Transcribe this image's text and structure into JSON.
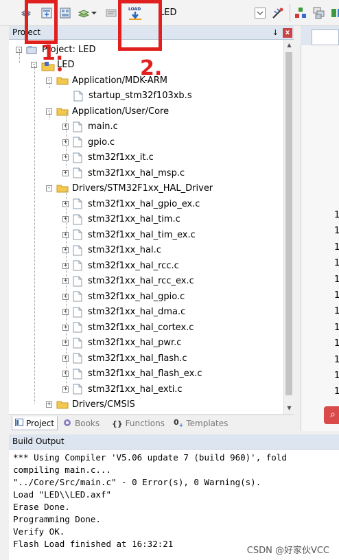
{
  "toolbar": {
    "target_name": "LED",
    "load_label": "LOAD"
  },
  "project_panel": {
    "title": "Project",
    "close_label": "x",
    "pin_label": "↓"
  },
  "tree": {
    "root_label": "Project: LED",
    "target_label": "LED",
    "groups": [
      {
        "label": "Application/MDK-ARM",
        "files": [
          "startup_stm32f103xb.s"
        ]
      },
      {
        "label": "Application/User/Core",
        "files": [
          "main.c",
          "gpio.c",
          "stm32f1xx_it.c",
          "stm32f1xx_hal_msp.c"
        ]
      },
      {
        "label": "Drivers/STM32F1xx_HAL_Driver",
        "files": [
          "stm32f1xx_hal_gpio_ex.c",
          "stm32f1xx_hal_tim.c",
          "stm32f1xx_hal_tim_ex.c",
          "stm32f1xx_hal.c",
          "stm32f1xx_hal_rcc.c",
          "stm32f1xx_hal_rcc_ex.c",
          "stm32f1xx_hal_gpio.c",
          "stm32f1xx_hal_dma.c",
          "stm32f1xx_hal_cortex.c",
          "stm32f1xx_hal_pwr.c",
          "stm32f1xx_hal_flash.c",
          "stm32f1xx_hal_flash_ex.c",
          "stm32f1xx_hal_exti.c"
        ]
      },
      {
        "label": "Drivers/CMSIS",
        "files": []
      }
    ]
  },
  "bottom_tabs": [
    {
      "label": "Project",
      "icon": "project-icon",
      "active": true
    },
    {
      "label": "Books",
      "icon": "books-icon",
      "active": false
    },
    {
      "label": "Functions",
      "icon": "functions-icon",
      "active": false
    },
    {
      "label": "Templates",
      "icon": "templates-icon",
      "active": false
    }
  ],
  "editor": {
    "line_digits": [
      "1",
      "1",
      "1",
      "1",
      "1",
      "1",
      "1",
      "1",
      "1",
      "1",
      "1",
      "1"
    ]
  },
  "build_output": {
    "title": "Build Output",
    "lines": [
      "*** Using Compiler 'V5.06 update 7 (build 960)', fold",
      "compiling main.c...",
      "\"../Core/Src/main.c\" - 0 Error(s), 0 Warning(s).",
      "Load \"LED\\\\LED.axf\"",
      "Erase Done.",
      "Programming Done.",
      "Verify OK.",
      "Flash Load finished at 16:32:21"
    ]
  },
  "watermark": "CSDN @好家伙VCC",
  "annotations": [
    {
      "label": "1."
    },
    {
      "label": "2."
    }
  ],
  "colors": {
    "annotation_red": "#e01f1f",
    "panel_header": "#dde6f0",
    "folder_yellow": "#f2c94c"
  }
}
